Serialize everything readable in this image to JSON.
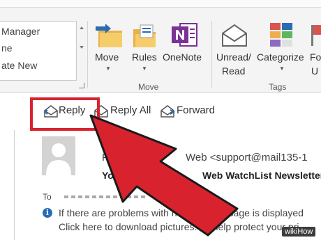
{
  "quick_steps": {
    "items": [
      "Manager",
      "ne",
      "ate New"
    ]
  },
  "ribbon": {
    "move_group": {
      "label": "Move",
      "move_button": "Move",
      "rules_button": "Rules",
      "onenote_button": "OneNote"
    },
    "tags_group": {
      "label": "Tags",
      "unread_read_line1": "Unread/",
      "unread_read_line2": "Read",
      "categorize_button": "Categorize",
      "follow_up_partial": "Fo",
      "follow_up_partial2": "U"
    }
  },
  "actions": {
    "reply": "Reply",
    "reply_all": "Reply All",
    "forward": "Forward"
  },
  "message": {
    "sender_partial_start": "Pr",
    "sender_partial_end": "Web <support@mail135-1",
    "subject_partial_start": "Your",
    "subject_partial_end": "Web WatchList Newsletter",
    "to_label": "To",
    "info_line1": "If there are problems with how this message is displayed",
    "info_line2": "Click here to download pictures. To help protect your pri"
  },
  "watermark": "wikiHow",
  "colors": {
    "highlight": "#d8232f",
    "arrow_fill": "#d8232f",
    "info_blue": "#2a6bb5",
    "onenote_purple": "#7b3295"
  },
  "icons": {
    "move": "folder-arrow-icon",
    "rules": "folder-rules-icon",
    "onenote": "onenote-icon",
    "unread": "envelope-open-icon",
    "categorize": "color-grid-icon",
    "reply": "reply-icon",
    "reply_all": "reply-all-icon",
    "forward": "forward-icon",
    "info": "info-icon"
  }
}
